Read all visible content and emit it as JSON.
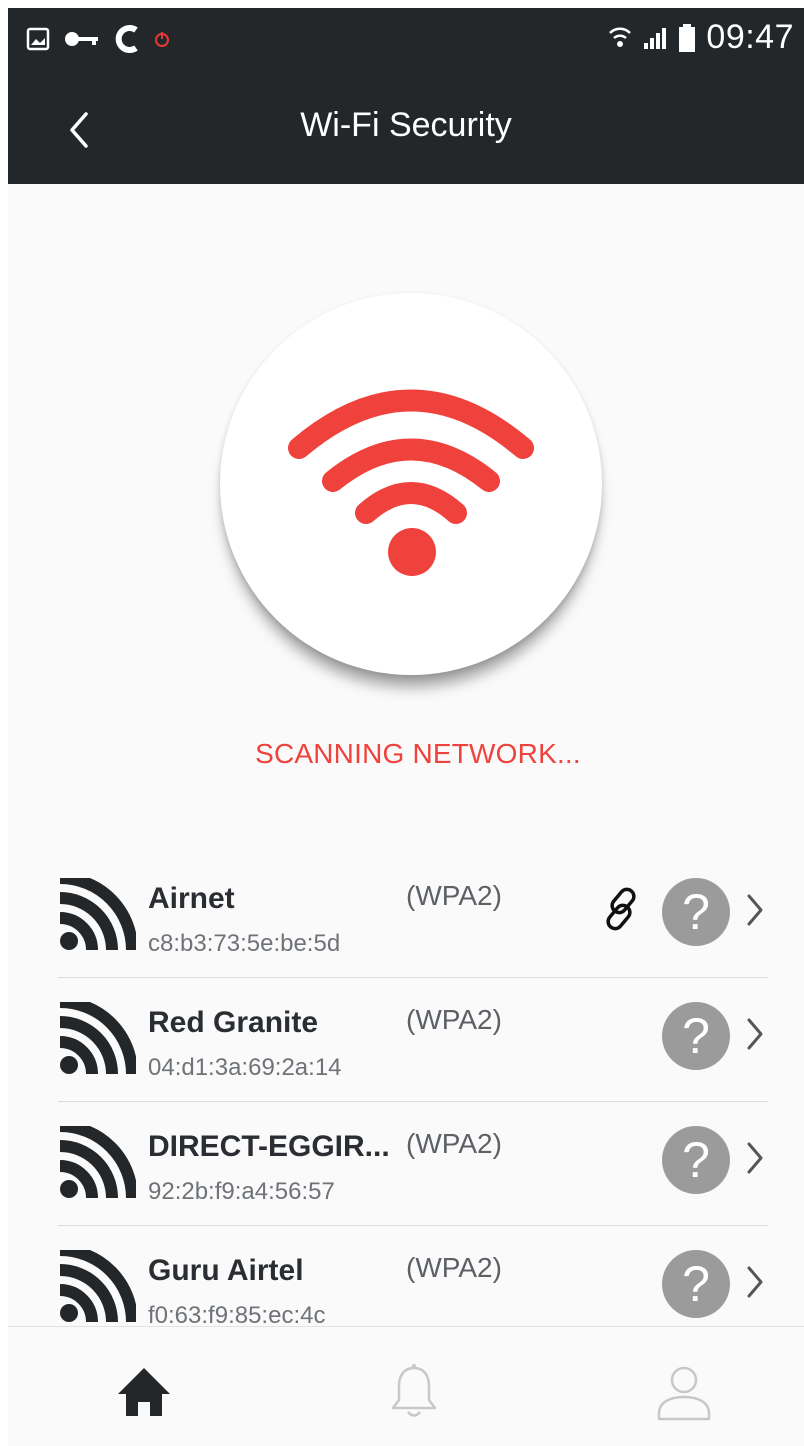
{
  "status_bar": {
    "time": "09:47",
    "left_icons": [
      "gallery-icon",
      "key-icon",
      "c-icon",
      "red-app-icon"
    ],
    "right_icons": [
      "wifi-status-icon",
      "signal-icon",
      "battery-icon"
    ]
  },
  "header": {
    "title": "Wi-Fi Security",
    "back_icon": "chevron-left-icon"
  },
  "scanner": {
    "status_text": "SCANNING NETWORK...",
    "icon": "wifi-icon",
    "accent": "#f0423c"
  },
  "networks": [
    {
      "name": "Airnet",
      "mac": "c8:b3:73:5e:be:5d",
      "security": "(WPA2)",
      "connected": true
    },
    {
      "name": "Red Granite",
      "mac": "04:d1:3a:69:2a:14",
      "security": "(WPA2)",
      "connected": false
    },
    {
      "name": "DIRECT-EGGIR...",
      "mac": "92:2b:f9:a4:56:57",
      "security": "(WPA2)",
      "connected": false
    },
    {
      "name": "Guru Airtel",
      "mac": "f0:63:f9:85:ec:4c",
      "security": "(WPA2)",
      "connected": false
    }
  ],
  "bottom_nav": [
    {
      "id": "home",
      "icon": "home-icon",
      "active": true
    },
    {
      "id": "notifications",
      "icon": "bell-icon",
      "active": false
    },
    {
      "id": "profile",
      "icon": "user-icon",
      "active": false
    }
  ],
  "colors": {
    "dark_bar": "#23272a",
    "accent_red": "#f0423c",
    "unknown_badge": "#9b9b9b"
  }
}
